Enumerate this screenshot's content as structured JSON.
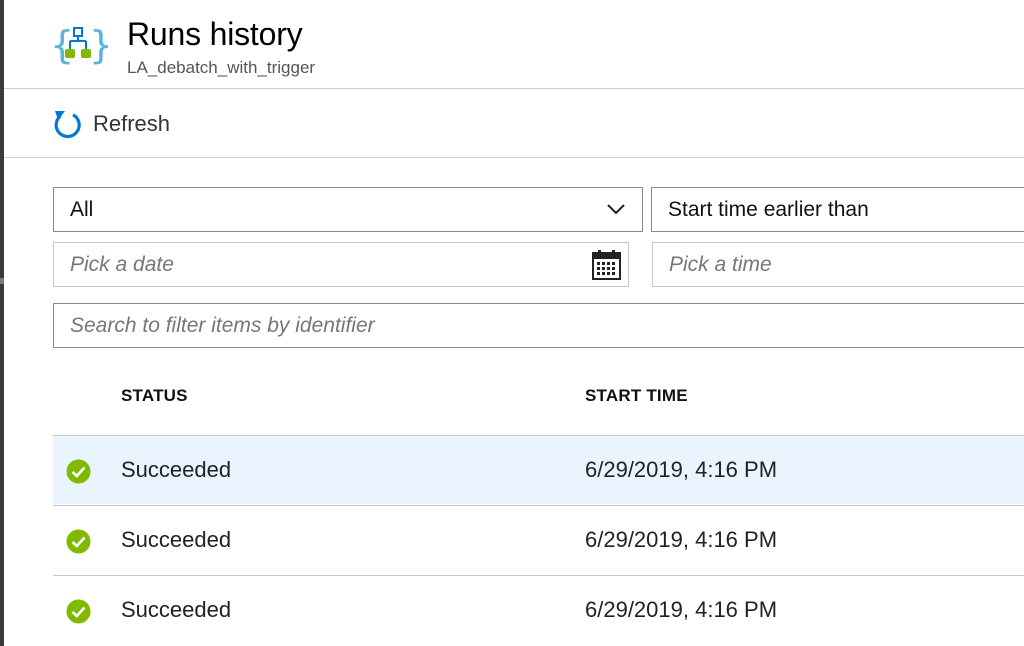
{
  "header": {
    "title": "Runs history",
    "subtitle": "LA_debatch_with_trigger",
    "icon": "logic-app-icon"
  },
  "toolbar": {
    "refresh_label": "Refresh",
    "refresh_icon": "refresh-icon"
  },
  "filters": {
    "status_value": "All",
    "time_compare_value": "Start time earlier than",
    "date_placeholder": "Pick a date",
    "time_placeholder": "Pick a time",
    "search_placeholder": "Search to filter items by identifier"
  },
  "table": {
    "columns": [
      "STATUS",
      "START TIME"
    ],
    "rows": [
      {
        "status": "Succeeded",
        "start_time": "6/29/2019, 4:16 PM",
        "selected": true
      },
      {
        "status": "Succeeded",
        "start_time": "6/29/2019, 4:16 PM",
        "selected": false
      },
      {
        "status": "Succeeded",
        "start_time": "6/29/2019, 4:16 PM",
        "selected": false
      }
    ]
  },
  "colors": {
    "accent": "#0078d4",
    "success": "#7fba00",
    "selected_row": "#e9f4fe",
    "icon_braces": "#59b4d9"
  }
}
